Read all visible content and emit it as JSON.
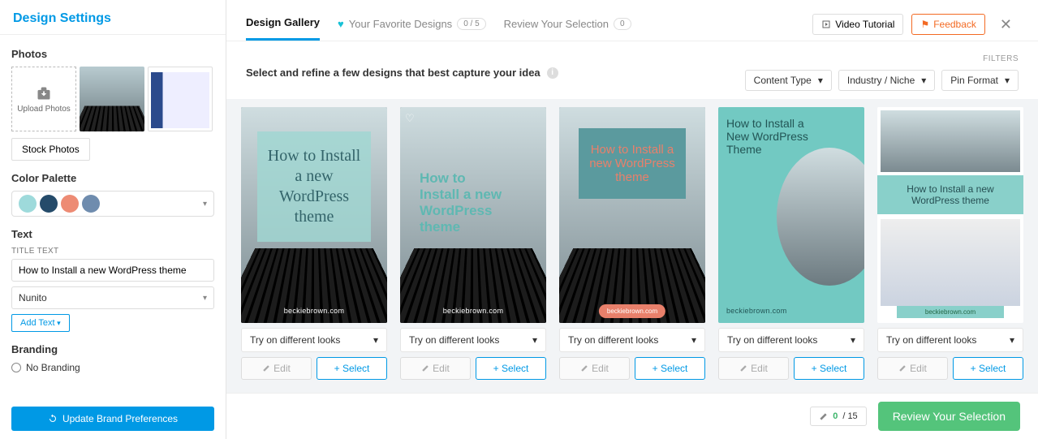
{
  "sidebar": {
    "title": "Design Settings",
    "photos_label": "Photos",
    "upload_label": "Upload Photos",
    "stock_photos": "Stock Photos",
    "palette_label": "Color Palette",
    "palette": [
      "#9edadb",
      "#254b6a",
      "#ed8b74",
      "#6f8cae"
    ],
    "text_label": "Text",
    "title_text_label": "TITLE TEXT",
    "title_text_value": "How to Install a new WordPress theme",
    "font_value": "Nunito",
    "add_text": "Add Text",
    "branding_label": "Branding",
    "no_branding": "No Branding",
    "update_btn": "Update Brand Preferences"
  },
  "top": {
    "tab_gallery": "Design Gallery",
    "tab_fav": "Your Favorite Designs",
    "fav_badge": "0 / 5",
    "tab_review": "Review Your Selection",
    "review_badge": "0",
    "video": "Video Tutorial",
    "feedback": "Feedback"
  },
  "subhead": {
    "text": "Select and refine a few designs that best capture your idea",
    "filters_label": "FILTERS",
    "f1": "Content Type",
    "f2": "Industry / Niche",
    "f3": "Pin Format"
  },
  "cards": {
    "title1": "How to Install a new WordPress theme",
    "title2": "How to Install a new WordPress theme",
    "title3": "How to Install a new WordPress theme",
    "title4": "How to Install a New WordPress Theme",
    "title5": "How to Install a new WordPress theme",
    "brand": "beckiebrown.com",
    "try": "Try on different looks",
    "edit": "Edit",
    "select": "Select"
  },
  "bottom": {
    "count_current": "0",
    "count_total": "/ 15",
    "review": "Review Your Selection"
  }
}
